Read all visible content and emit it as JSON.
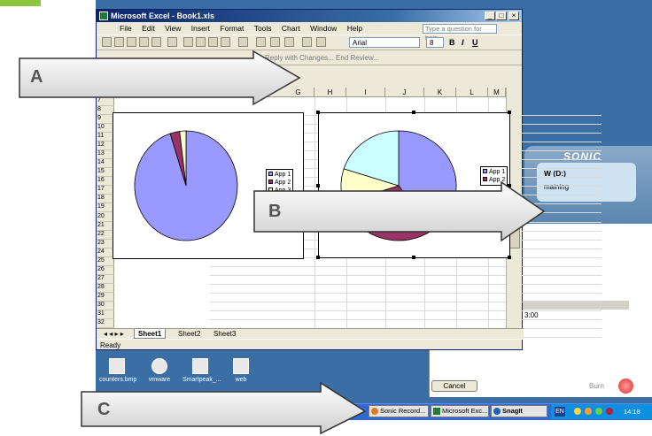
{
  "excel": {
    "title": "Microsoft Excel - Book1.xls",
    "win_buttons": [
      "_",
      "□",
      "×"
    ],
    "menu": [
      "File",
      "Edit",
      "View",
      "Insert",
      "Format",
      "Tools",
      "Chart",
      "Window",
      "Help"
    ],
    "help_placeholder": "Type a question for help",
    "font": "Arial",
    "font_size": "8",
    "format_buttons": [
      "B",
      "I",
      "U"
    ],
    "review": "Reply with Changes... End Review...",
    "columns": [
      "G",
      "H",
      "I",
      "J",
      "K",
      "L",
      "M"
    ],
    "rows": [
      "7",
      "8",
      "9",
      "10",
      "11",
      "12",
      "13",
      "14",
      "15",
      "16",
      "17",
      "18",
      "19",
      "20",
      "21",
      "22",
      "23",
      "24",
      "25",
      "26",
      "27",
      "28",
      "29",
      "30",
      "31",
      "32"
    ],
    "sheets": [
      "Sheet1",
      "Sheet2",
      "Sheet3"
    ],
    "status": "Ready"
  },
  "chart1": {
    "chart_data": {
      "type": "pie",
      "series": [
        {
          "values": [
            95,
            3,
            2
          ]
        }
      ],
      "categories": [
        "App 1",
        "App 2",
        "App 3"
      ],
      "colors": [
        "#9999ff",
        "#993366",
        "#ffffcc"
      ]
    },
    "legend": [
      "App 1",
      "App 2",
      "App 3"
    ]
  },
  "chart2": {
    "chart_data": {
      "type": "pie",
      "series": [
        {
          "values": [
            40,
            30,
            10,
            20
          ]
        }
      ],
      "categories": [
        "App 1",
        "App 2",
        "App 3",
        "App 4"
      ],
      "colors": [
        "#9999ff",
        "#993366",
        "#ffffcc",
        "#ccffff"
      ]
    },
    "legend": [
      "App 1",
      "App 2"
    ]
  },
  "sonic": {
    "brand": "SONIC",
    "drive": "W (D:)",
    "remaining": "maining",
    "time": "3:00",
    "cancel": "Cancel",
    "burn": "Burn"
  },
  "desktop": {
    "icons": [
      "counters.bmp",
      "vmware",
      "Smartpeak_...",
      "web"
    ]
  },
  "taskbar": {
    "items": [
      "Sonic Record...",
      "Microsoft Exc...",
      "SnagIt"
    ],
    "lang": "EN",
    "clock": "14:18"
  },
  "callouts": [
    "A",
    "B",
    "C"
  ]
}
